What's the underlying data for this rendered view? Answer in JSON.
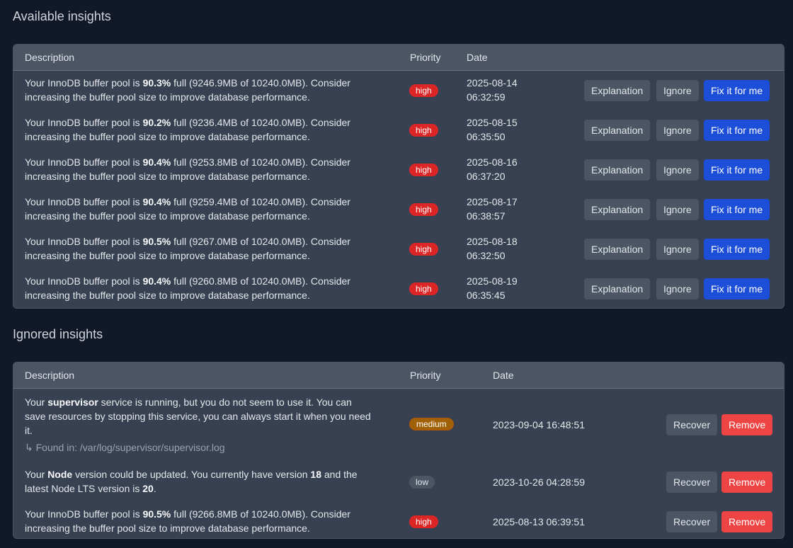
{
  "available": {
    "title": "Available insights",
    "headers": {
      "description": "Description",
      "priority": "Priority",
      "date": "Date"
    },
    "rows": [
      {
        "pre": "Your InnoDB buffer pool is ",
        "pct": "90.3%",
        "post": " full (9246.9MB of 10240.0MB). Consider increasing the buffer pool size to improve database performance.",
        "priority": "high",
        "date": "2025-08-14",
        "time": "06:32:59"
      },
      {
        "pre": "Your InnoDB buffer pool is ",
        "pct": "90.2%",
        "post": " full (9236.4MB of 10240.0MB). Consider increasing the buffer pool size to improve database performance.",
        "priority": "high",
        "date": "2025-08-15",
        "time": "06:35:50"
      },
      {
        "pre": "Your InnoDB buffer pool is ",
        "pct": "90.4%",
        "post": " full (9253.8MB of 10240.0MB). Consider increasing the buffer pool size to improve database performance.",
        "priority": "high",
        "date": "2025-08-16",
        "time": "06:37:20"
      },
      {
        "pre": "Your InnoDB buffer pool is ",
        "pct": "90.4%",
        "post": " full (9259.4MB of 10240.0MB). Consider increasing the buffer pool size to improve database performance.",
        "priority": "high",
        "date": "2025-08-17",
        "time": "06:38:57"
      },
      {
        "pre": "Your InnoDB buffer pool is ",
        "pct": "90.5%",
        "post": " full (9267.0MB of 10240.0MB). Consider increasing the buffer pool size to improve database performance.",
        "priority": "high",
        "date": "2025-08-18",
        "time": "06:32:50"
      },
      {
        "pre": "Your InnoDB buffer pool is ",
        "pct": "90.4%",
        "post": " full (9260.8MB of 10240.0MB). Consider increasing the buffer pool size to improve database performance.",
        "priority": "high",
        "date": "2025-08-19",
        "time": "06:35:45"
      }
    ],
    "buttons": {
      "explanation": "Explanation",
      "ignore": "Ignore",
      "fix": "Fix it for me"
    }
  },
  "ignored": {
    "title": "Ignored insights",
    "headers": {
      "description": "Description",
      "priority": "Priority",
      "date": "Date"
    },
    "rows": [
      {
        "line1_pre": "Your ",
        "line1_bold": "supervisor",
        "line1_post": " service is running, but you do not seem to use it. You can",
        "line2": "save resources by stopping this service, you can always start it when you need",
        "line3": "it.",
        "found": "Found in: /var/log/supervisor/supervisor.log",
        "priority": "medium",
        "date": "2023-09-04 16:48:51"
      },
      {
        "line1_pre": "Your ",
        "line1_bold": "Node",
        "line1_post": " version could be updated. You currently have version ",
        "line1_bold2": "18",
        "line1_post2": " and the",
        "line2_pre": "latest Node LTS version is ",
        "line2_bold": "20",
        "line2_post": ".",
        "priority": "low",
        "date": "2023-10-26 04:28:59"
      },
      {
        "line1_pre": "Your InnoDB buffer pool is ",
        "line1_bold": "90.5%",
        "line1_post": " full (9266.8MB of 10240.0MB). Consider",
        "line2": "increasing the buffer pool size to improve database performance.",
        "priority": "high",
        "date": "2025-08-13 06:39:51"
      }
    ],
    "buttons": {
      "recover": "Recover",
      "remove": "Remove"
    },
    "found_arrow": "↳"
  },
  "colors": {
    "background": "#111827",
    "panel": "#374151",
    "header": "#4b5563",
    "high": "#dc2626",
    "medium": "#a16207",
    "low": "#4b5563",
    "primary": "#1d4ed8",
    "danger": "#ef4444"
  }
}
